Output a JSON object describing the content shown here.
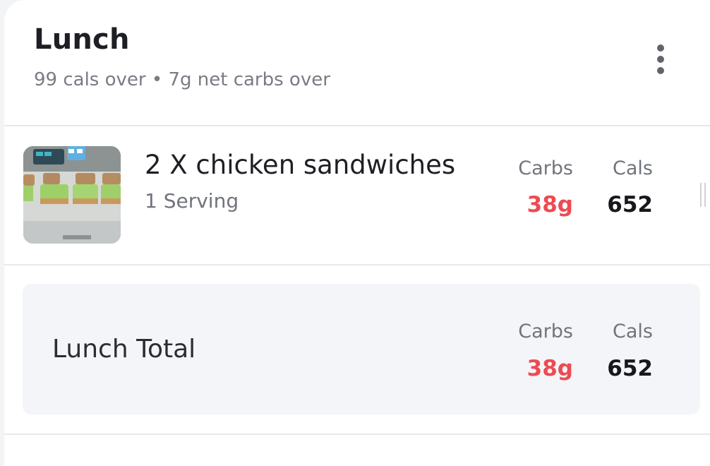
{
  "meal": {
    "title": "Lunch",
    "summary": "99 cals over • 7g net carbs over",
    "menu_icon": "more-vertical-icon"
  },
  "entries": [
    {
      "name": "2 X chicken sandwiches",
      "serving": "1 Serving",
      "carbs_label": "Carbs",
      "carbs_value": "38g",
      "cals_label": "Cals",
      "cals_value": "652"
    }
  ],
  "total": {
    "label": "Lunch Total",
    "carbs_label": "Carbs",
    "carbs_value": "38g",
    "cals_label": "Cals",
    "cals_value": "652"
  },
  "colors": {
    "over_limit": "#ee4a52",
    "text_primary": "#1e1f24",
    "text_secondary": "#72747d",
    "total_background": "#f4f5f8"
  }
}
